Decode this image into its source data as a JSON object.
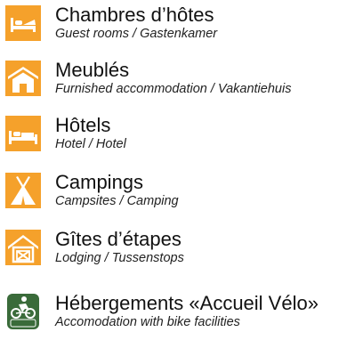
{
  "colors": {
    "orange": "#f5a12b",
    "green": "#3a6b3a",
    "white": "#ffffff"
  },
  "items": [
    {
      "icon": "bed-icon",
      "title": "Chambres d’hôtes",
      "subtitle": "Guest rooms / Gastenkamer"
    },
    {
      "icon": "house-icon",
      "title": "Meublés",
      "subtitle": "Furnished accommodation / Vakantiehuis"
    },
    {
      "icon": "hotel-bed-icon",
      "title": "Hôtels",
      "subtitle": "Hotel / Hotel"
    },
    {
      "icon": "tent-icon",
      "title": "Campings",
      "subtitle": "Campsites / Camping"
    },
    {
      "icon": "cabin-icon",
      "title": "Gîtes d’étapes",
      "subtitle": "Lodging / Tussenstops"
    },
    {
      "icon": "cyclist-icon",
      "title": "Hébergements «Accueil Vélo»",
      "subtitle": "Accomodation with bike facilities",
      "badge_text": "ACCUEIL VÉLO"
    }
  ]
}
